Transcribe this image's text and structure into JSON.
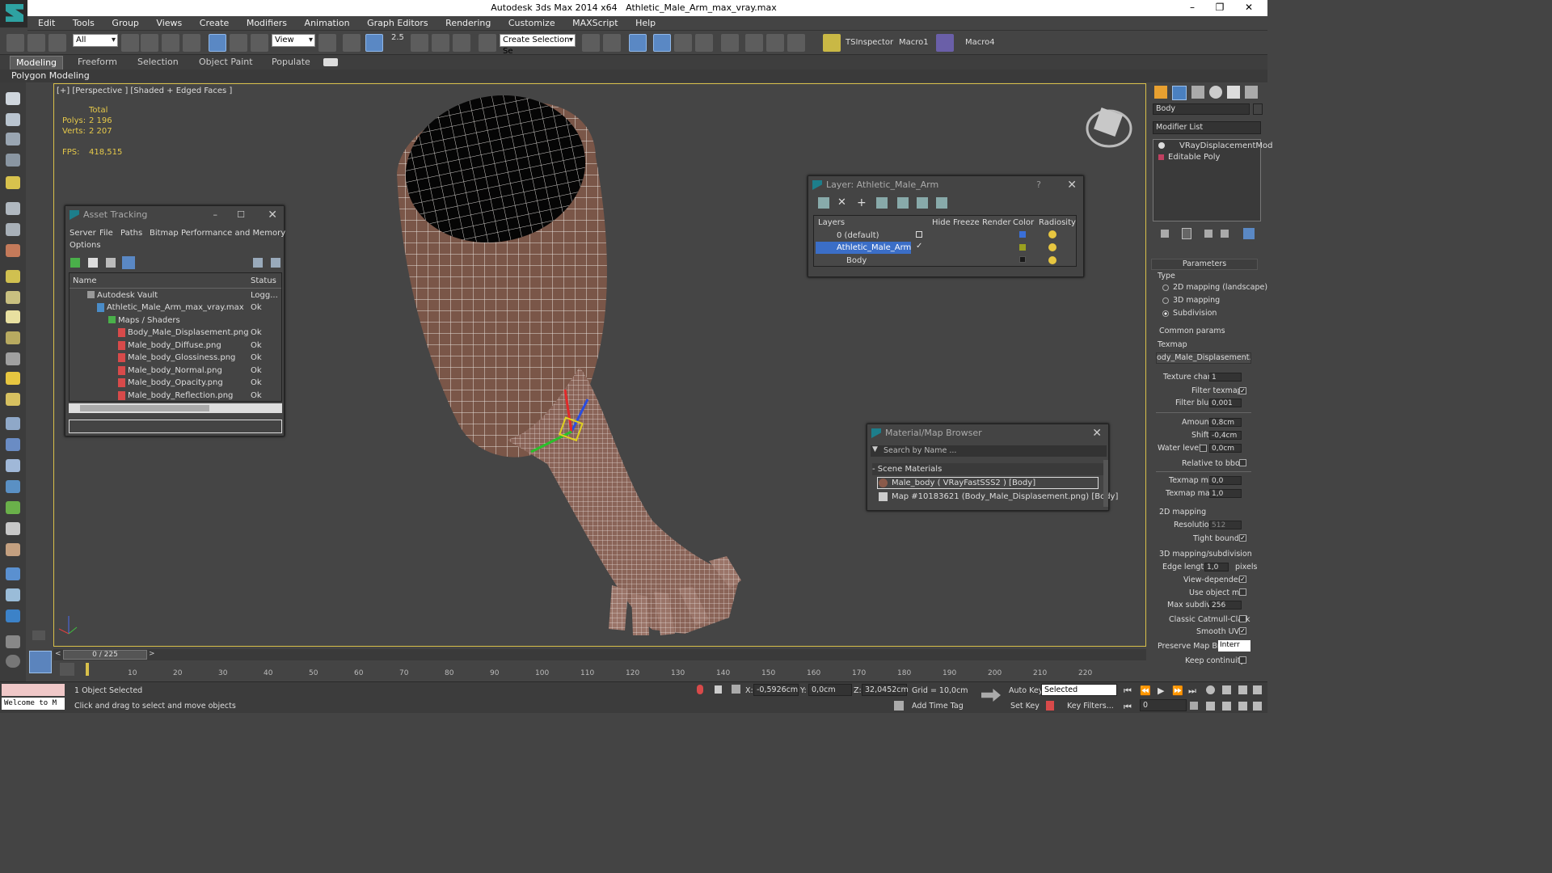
{
  "window": {
    "app_title": "Autodesk 3ds Max  2014 x64",
    "file_title": "Athletic_Male_Arm_max_vray.max"
  },
  "menu": [
    "Edit",
    "Tools",
    "Group",
    "Views",
    "Create",
    "Modifiers",
    "Animation",
    "Graph Editors",
    "Rendering",
    "Customize",
    "MAXScript",
    "Help"
  ],
  "toolbar": {
    "filter_select": "All",
    "coord_select": "View",
    "snap_label": "2.5",
    "selection_set_placeholder": "Create Selection Se",
    "macros": [
      "TSInspector",
      "Macro1",
      "Macro4"
    ]
  },
  "ribbon": {
    "tabs": [
      "Modeling",
      "Freeform",
      "Selection",
      "Object Paint",
      "Populate"
    ],
    "active_tab": "Modeling",
    "sub_label": "Polygon Modeling"
  },
  "viewport": {
    "label": "[+] [Perspective ] [Shaded + Edged Faces ]",
    "stats": {
      "total_label": "Total",
      "polys_label": "Polys:",
      "polys_value": "2 196",
      "verts_label": "Verts:",
      "verts_value": "2 207",
      "fps_label": "FPS:",
      "fps_value": "418,515"
    }
  },
  "asset_tracking": {
    "title": "Asset Tracking",
    "menu": [
      "Server",
      "File",
      "Paths",
      "Bitmap Performance and Memory",
      "Options"
    ],
    "col_name": "Name",
    "col_status": "Status",
    "rows": [
      {
        "name": "Autodesk Vault",
        "status": "Logg..."
      },
      {
        "name": "Athletic_Male_Arm_max_vray.max",
        "status": "Ok"
      },
      {
        "name": "Maps / Shaders",
        "status": ""
      },
      {
        "name": "Body_Male_Displasement.png",
        "status": "Ok"
      },
      {
        "name": "Male_body_Diffuse.png",
        "status": "Ok"
      },
      {
        "name": "Male_body_Glossiness.png",
        "status": "Ok"
      },
      {
        "name": "Male_body_Normal.png",
        "status": "Ok"
      },
      {
        "name": "Male_body_Opacity.png",
        "status": "Ok"
      },
      {
        "name": "Male_body_Reflection.png",
        "status": "Ok"
      }
    ]
  },
  "layer_dialog": {
    "title": "Layer: Athletic_Male_Arm",
    "help": "?",
    "columns": [
      "Layers",
      "Hide",
      "Freeze",
      "Render",
      "Color",
      "Radiosity"
    ],
    "rows": [
      {
        "name": "0 (default)",
        "color": "#3a6fd8"
      },
      {
        "name": "Athletic_Male_Arm",
        "color": "#9aa020"
      },
      {
        "name": "Body",
        "color": "#1a1a1a"
      }
    ]
  },
  "material_browser": {
    "title": "Material/Map Browser",
    "search_placeholder": "Search by Name ...",
    "section": "- Scene Materials",
    "items": [
      "Male_body  ( VRayFastSSS2 )  [Body]",
      "Map #10183621 (Body_Male_Displasement.png) [Body]"
    ]
  },
  "command_panel": {
    "object_name": "Body",
    "modifier_list": "Modifier List",
    "stack": [
      "VRayDisplacementMod",
      "Editable Poly"
    ],
    "parameters_title": "Parameters",
    "type_label": "Type",
    "type_options": [
      "2D mapping (landscape)",
      "3D mapping",
      "Subdivision"
    ],
    "common_params": "Common params",
    "texmap_label": "Texmap",
    "texmap_value": "ody_Male_Displasement.png)",
    "texture_chan_label": "Texture chan",
    "texture_chan": "1",
    "filter_texmap": "Filter texmap",
    "filter_blur_label": "Filter blur",
    "filter_blur": "0,001",
    "amount_label": "Amount",
    "amount": "0,8cm",
    "shift_label": "Shift",
    "shift": "-0,4cm",
    "water_level_label": "Water level",
    "water_level": "0,0cm",
    "relative_bbox": "Relative to bbox",
    "texmap_min_label": "Texmap min",
    "texmap_min": "0,0",
    "texmap_max_label": "Texmap max",
    "texmap_max": "1,0",
    "mapping_2d": "2D mapping",
    "resolution_label": "Resolution",
    "resolution": "512",
    "tight_bounds": "Tight bounds",
    "mapping_3d": "3D mapping/subdivision",
    "edge_length_label": "Edge length",
    "edge_length": "1,0",
    "pixels": "pixels",
    "view_dependent": "View-dependent",
    "use_object_mtl": "Use object mtl",
    "max_subdivs_label": "Max subdivs",
    "max_subdivs": "256",
    "classic_catmull": "Classic Catmull-Clark",
    "smooth_uvs": "Smooth UVs",
    "preserve_map_bnd": "Preserve Map Bnd",
    "preserve_value": "Interr",
    "keep_continuity": "Keep continuity"
  },
  "timeline": {
    "frame": "0 / 225",
    "ticks": [
      "0",
      "10",
      "20",
      "30",
      "40",
      "50",
      "60",
      "70",
      "80",
      "90",
      "100",
      "110",
      "120",
      "130",
      "140",
      "150",
      "160",
      "170",
      "180",
      "190",
      "200",
      "210",
      "220"
    ]
  },
  "status": {
    "script_text": "Welcome to M",
    "selected_text": "1 Object Selected",
    "prompt_text": "Click and drag to select and move objects",
    "x_label": "X:",
    "x_value": "-0,5926cm",
    "y_label": "Y:",
    "y_value": "0,0cm",
    "z_label": "Z:",
    "z_value": "32,0452cm",
    "grid": "Grid = 10,0cm",
    "add_time_tag": "Add Time Tag",
    "auto_key": "Auto Key",
    "set_key": "Set Key",
    "selected_combo": "Selected",
    "key_filters": "Key Filters...",
    "frame_value": "0"
  }
}
